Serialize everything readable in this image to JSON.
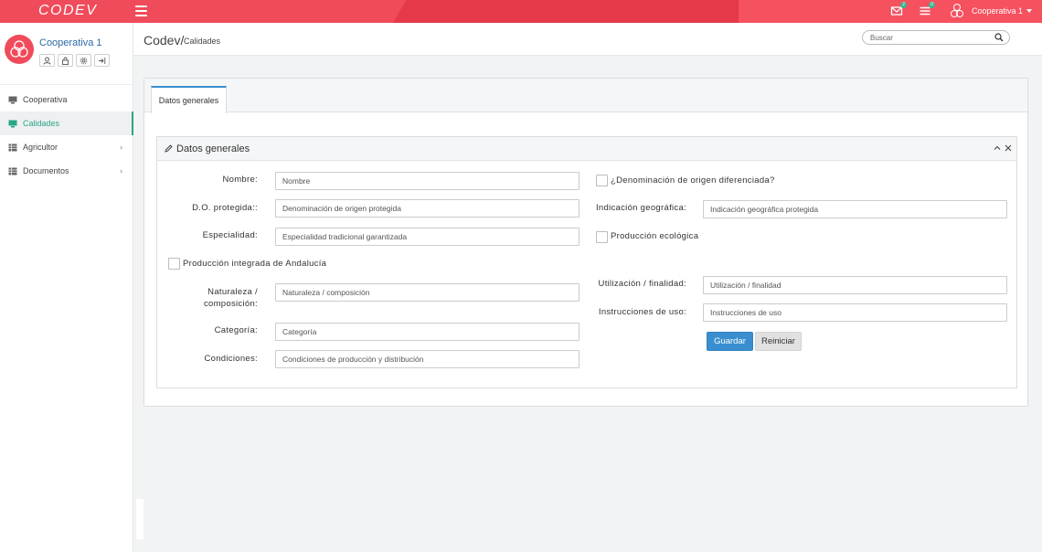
{
  "topbar": {
    "logo": "CODEV",
    "messages_badge": "2",
    "tasks_badge": "0",
    "user_label": "Cooperativa 1",
    "colors": {
      "primary": "#f04b5a",
      "accent": "#3bb58f"
    }
  },
  "profile": {
    "name": "Cooperativa 1"
  },
  "sidebar": {
    "items": [
      {
        "label": "Cooperativa",
        "icon": "monitor-icon",
        "active": false
      },
      {
        "label": "Calidades",
        "icon": "monitor-icon",
        "active": true
      },
      {
        "label": "Agricultor",
        "icon": "table-icon",
        "active": false
      },
      {
        "label": "Documentos",
        "icon": "table-icon",
        "active": false
      }
    ]
  },
  "header": {
    "crumb_main": "Codev/",
    "crumb_sub": "Calidades",
    "search_placeholder": "Buscar"
  },
  "tabs": [
    {
      "label": "Datos generales",
      "active": true
    }
  ],
  "form": {
    "title": "Datos generales",
    "left": {
      "nombre": {
        "label": "Nombre:",
        "placeholder": "Nombre"
      },
      "do_protegida": {
        "label": "D.O. protegida::",
        "placeholder": "Denominación de origen protegida"
      },
      "especialidad": {
        "label": "Especialidad:",
        "placeholder": "Especialidad tradicional garantizada"
      },
      "produccion_integrada": {
        "label": "Producción integrada de Andalucía"
      },
      "naturaleza_line1": "Naturaleza /",
      "naturaleza_line2": "composición:",
      "naturaleza_placeholder": "Naturaleza / composición",
      "categoria": {
        "label": "Categoría:",
        "placeholder": "Categoría"
      },
      "condiciones": {
        "label": "Condiciones:",
        "placeholder": "Condiciones de producción y distribución"
      }
    },
    "right": {
      "denominacion_diferenciada": {
        "label": "¿Denominación de origen diferenciada?"
      },
      "indicacion": {
        "label": "Indicación geográfica:",
        "placeholder": "Indicación geográfica protegida"
      },
      "produccion_ecologica": {
        "label": "Producción ecológica"
      },
      "utilizacion": {
        "label": "Utilización / finalidad:",
        "placeholder": "Utilización / finalidad"
      },
      "instrucciones": {
        "label": "Instrucciones de uso:",
        "placeholder": "Instrucciones de uso"
      },
      "save_label": "Guardar",
      "reset_label": "Reiniciar"
    }
  }
}
